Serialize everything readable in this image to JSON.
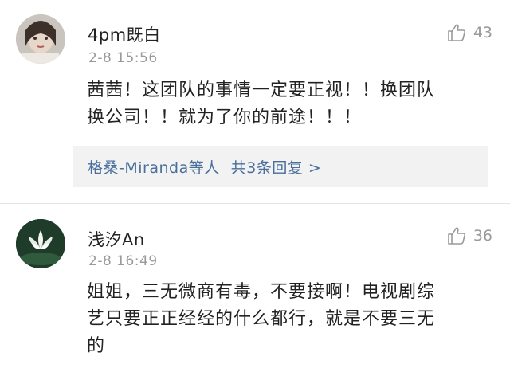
{
  "comments": [
    {
      "username": "4pm既白",
      "timestamp": "2-8 15:56",
      "likes": "43",
      "avatar_icon": "user-avatar-photo",
      "text_line1": "茜茜！这团队的事情一定要正视！！换团队",
      "text_line2": "换公司！！就为了你的前途！！！",
      "replies": {
        "names": "格桑-Miranda等人",
        "summary": "共3条回复 >"
      }
    },
    {
      "username": "浅汐An",
      "timestamp": "2-8 16:49",
      "likes": "36",
      "avatar_icon": "lotus-avatar",
      "text_line1": "姐姐，三无微商有毒，不要接啊！电视剧综",
      "text_line2": "艺只要正正经经的什么都行，就是不要三无",
      "text_line3": "的"
    }
  ],
  "colors": {
    "link": "#4a6f9c",
    "muted": "#9a9a9a",
    "reply_bg": "#f2f2f2"
  }
}
